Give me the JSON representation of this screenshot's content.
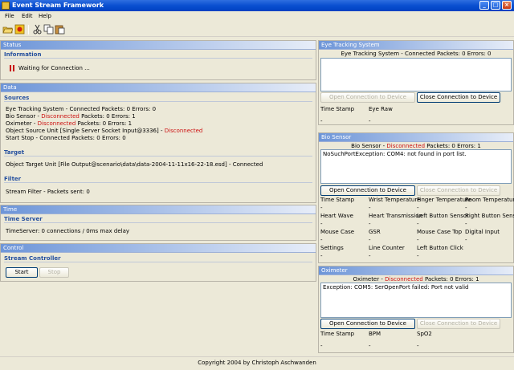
{
  "window": {
    "title": "Event Stream Framework",
    "icon": "app-icon",
    "minimize": "_",
    "maximize": "□",
    "close": "×"
  },
  "menu": {
    "file": "File",
    "edit": "Edit",
    "help": "Help"
  },
  "toolbar": {
    "icons": [
      "open-folder-icon",
      "record-icon",
      "cut-icon",
      "copy-icon",
      "paste-icon"
    ]
  },
  "status": {
    "header": "Status",
    "information_title": "Information",
    "message": "Waiting for Connection ..."
  },
  "data": {
    "header": "Data",
    "sources_title": "Sources",
    "sources": {
      "eye": "Eye Tracking System - Connected Packets: 0 Errors: 0",
      "bio_prefix": "Bio Sensor - ",
      "bio_state": "Disconnected",
      "bio_suffix": " Packets: 0 Errors: 1",
      "oxi_prefix": "Oximeter - ",
      "oxi_state": "Disconnected",
      "oxi_suffix": " Packets: 0 Errors: 1",
      "obj_prefix": "Object Source Unit [Single Server Socket Input@3336] - ",
      "obj_state": "Disconnected",
      "start_stop": "Start Stop - Connected Packets: 0 Errors: 0"
    },
    "target_title": "Target",
    "target": "Object Target Unit [File Output@scenario\\data\\data-2004-11-11x16-22-18.esd] - Connected",
    "filter_title": "Filter",
    "filter": "Stream Filter - Packets sent: 0"
  },
  "time": {
    "header": "Time",
    "server_title": "Time Server",
    "server": "TimeServer: 0 connections / 0ms max delay"
  },
  "control": {
    "header": "Control",
    "controller_title": "Stream Controller",
    "start": "Start",
    "stop": "Stop"
  },
  "eye_panel": {
    "header": "Eye Tracking System",
    "status": "Eye Tracking System - Connected Packets: 0 Errors: 0",
    "open": "Open Connection to Device",
    "close": "Close Connection to Device",
    "fields": [
      {
        "label": "Time Stamp",
        "value": "-"
      },
      {
        "label": "Eye Raw",
        "value": "-"
      }
    ]
  },
  "bio_panel": {
    "header": "Bio Sensor",
    "status_prefix": "Bio Sensor - ",
    "status_state": "Disconnected",
    "status_suffix": " Packets: 0 Errors: 1",
    "log": "NoSuchPortException: COM4: not found in port list.",
    "open": "Open Connection to Device",
    "close": "Close Connection to Device",
    "fields": [
      {
        "label": "Time Stamp",
        "value": "-"
      },
      {
        "label": "Wrist Temperature",
        "value": "-"
      },
      {
        "label": "Finger Temperature",
        "value": "-"
      },
      {
        "label": "Room Temperature",
        "value": "-"
      },
      {
        "label": "Heart Wave",
        "value": "-"
      },
      {
        "label": "Heart Transmission",
        "value": "-"
      },
      {
        "label": "Left Button Sensor",
        "value": "-"
      },
      {
        "label": "Right Button Sensor",
        "value": "-"
      },
      {
        "label": "Mouse Case",
        "value": "-"
      },
      {
        "label": "GSR",
        "value": "-"
      },
      {
        "label": "Mouse Case Top",
        "value": "-"
      },
      {
        "label": "Digital Input",
        "value": "-"
      },
      {
        "label": "Settings",
        "value": "-"
      },
      {
        "label": "Line Counter",
        "value": "-"
      },
      {
        "label": "Left Button Click",
        "value": "-"
      }
    ]
  },
  "oxi_panel": {
    "header": "Oximeter",
    "status_prefix": "Oximeter - ",
    "status_state": "Disconnected",
    "status_suffix": " Packets: 0 Errors: 1",
    "log": "Exception: COM5: SerOpenPort failed: Port not valid",
    "open": "Open Connection to Device",
    "close": "Close Connection to Device",
    "fields": [
      {
        "label": "Time Stamp",
        "value": "-"
      },
      {
        "label": "BPM",
        "value": "-"
      },
      {
        "label": "SpO2",
        "value": "-"
      }
    ]
  },
  "footer": "Copyright 2004 by Christoph Aschwanden"
}
